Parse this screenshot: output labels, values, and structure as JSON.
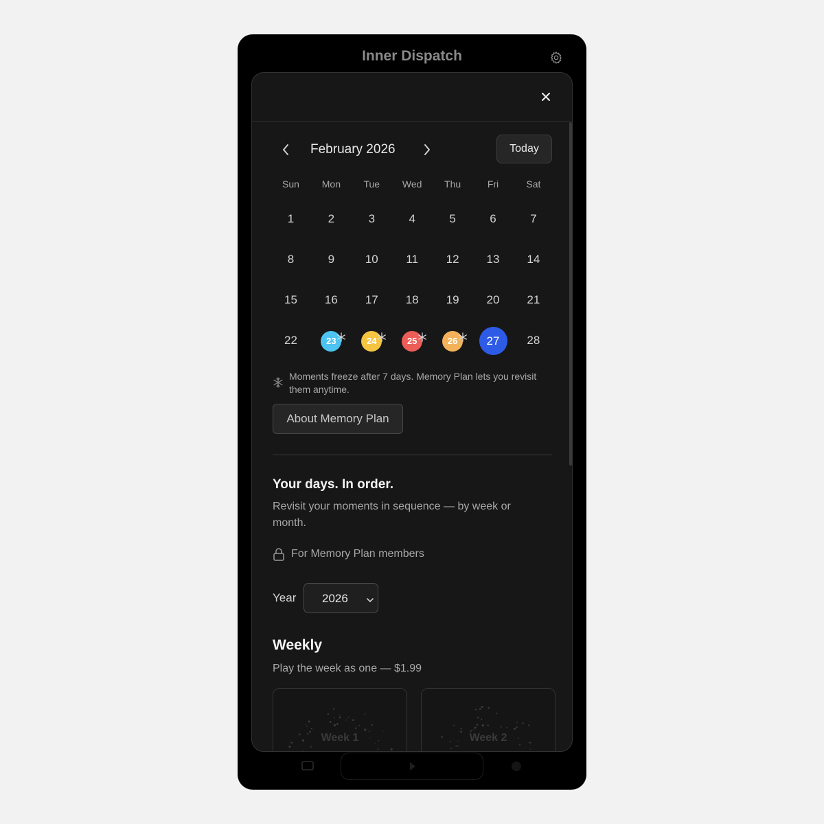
{
  "app": {
    "title": "Inner Dispatch"
  },
  "icons": {
    "settings": "gear-icon",
    "close": "close-icon",
    "prev": "chevron-left-icon",
    "next": "chevron-right-icon",
    "snowflake": "snowflake-icon",
    "lock": "lock-icon",
    "select": "chevron-down-icon"
  },
  "calendar": {
    "month_label": "February 2026",
    "today_label": "Today",
    "weekdays": [
      "Sun",
      "Mon",
      "Tue",
      "Wed",
      "Thu",
      "Fri",
      "Sat"
    ],
    "days": [
      "1",
      "2",
      "3",
      "4",
      "5",
      "6",
      "7",
      "8",
      "9",
      "10",
      "11",
      "12",
      "13",
      "14",
      "15",
      "16",
      "17",
      "18",
      "19",
      "20",
      "21",
      "22",
      "23",
      "24",
      "25",
      "26",
      "27",
      "28"
    ],
    "frozen_days": [
      {
        "day": "23",
        "color": "#4cc3f0"
      },
      {
        "day": "24",
        "color": "#f5c542"
      },
      {
        "day": "25",
        "color": "#ec5d57"
      },
      {
        "day": "26",
        "color": "#f3b259"
      }
    ],
    "selected_day": "27",
    "selected_color": "#2e5be6"
  },
  "freeze_note": "Moments freeze after 7 days. Memory Plan lets you revisit them anytime.",
  "about_button": "About Memory Plan",
  "section": {
    "title": "Your days. In order.",
    "description": "Revisit your moments in sequence — by week or month.",
    "lock_text": "For Memory Plan members"
  },
  "year": {
    "label": "Year",
    "value": "2026"
  },
  "weekly": {
    "title": "Weekly",
    "description": "Play the week as one — $1.99",
    "cards": [
      "Week 1",
      "Week 2"
    ]
  }
}
